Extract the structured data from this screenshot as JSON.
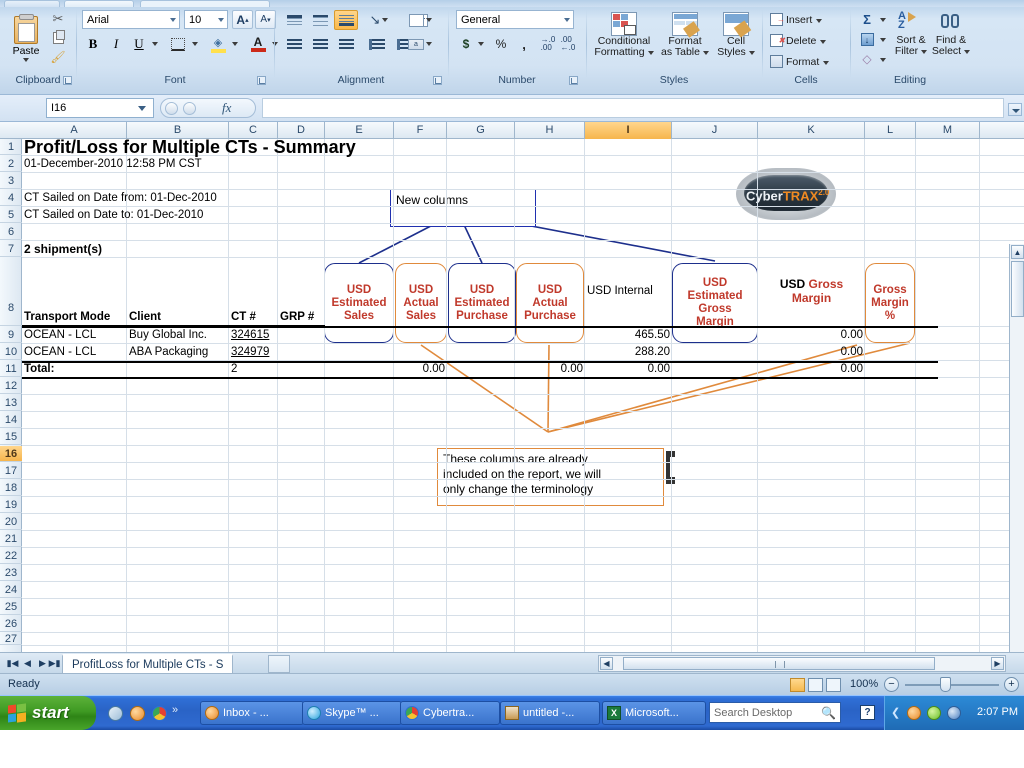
{
  "ribbon": {
    "groups": [
      {
        "name": "Clipboard",
        "label": "Clipboard"
      },
      {
        "name": "Font",
        "label": "Font"
      },
      {
        "name": "Alignment",
        "label": "Alignment"
      },
      {
        "name": "Number",
        "label": "Number"
      },
      {
        "name": "Styles",
        "label": "Styles"
      },
      {
        "name": "Cells",
        "label": "Cells"
      },
      {
        "name": "Editing",
        "label": "Editing"
      }
    ],
    "clipboard": {
      "paste": "Paste",
      "cut": "cut-icon",
      "copy": "copy-icon",
      "format_painter": "format-painter-icon"
    },
    "font": {
      "font_name": "Arial",
      "font_size": "10",
      "grow": "A",
      "shrink": "A",
      "bold": "B",
      "italic": "I",
      "underline": "U"
    },
    "number": {
      "format": "General",
      "currency": "$",
      "percent": "%",
      "comma": ","
    },
    "styles": {
      "conditional_formatting_l1": "Conditional",
      "conditional_formatting_l2": "Formatting",
      "format_as_table_l1": "Format",
      "format_as_table_l2": "as Table",
      "cell_styles_l1": "Cell",
      "cell_styles_l2": "Styles"
    },
    "cells": {
      "insert": "Insert",
      "delete": "Delete",
      "format": "Format"
    },
    "editing": {
      "autosum": "Σ",
      "sort_filter_l1": "Sort &",
      "sort_filter_l2": "Filter",
      "find_select_l1": "Find &",
      "find_select_l2": "Select"
    }
  },
  "formula_bar": {
    "name_box": "I16",
    "formula_value": "",
    "fx_label": "fx"
  },
  "grid": {
    "columns": [
      "A",
      "B",
      "C",
      "D",
      "E",
      "F",
      "G",
      "H",
      "I",
      "J",
      "K",
      "L",
      "M"
    ],
    "selected_column": "I",
    "rows": [
      "1",
      "2",
      "3",
      "4",
      "5",
      "6",
      "7",
      "8",
      "9",
      "10",
      "11",
      "12",
      "13",
      "14",
      "15",
      "16",
      "17",
      "18",
      "19",
      "20",
      "21",
      "22",
      "23",
      "24",
      "25",
      "26",
      "27"
    ],
    "selected_row": "16",
    "content": {
      "title": "Profit/Loss for Multiple CTs - Summary",
      "timestamp": "01-December-2010 12:58 PM CST",
      "sailed_from": "CT Sailed on Date from: 01-Dec-2010",
      "sailed_to": "CT Sailed on Date to: 01-Dec-2010",
      "shipment_count": "2 shipment(s)",
      "headers": {
        "transport_mode": "Transport Mode",
        "client": "Client",
        "ct_number": "CT #",
        "grp_number": "GRP #"
      },
      "column_boxes": [
        {
          "col": "E",
          "outline": "blue",
          "lines": [
            "USD",
            "Estimated",
            "Sales"
          ]
        },
        {
          "col": "F",
          "outline": "orange",
          "lines": [
            "USD",
            "Actual",
            "Sales"
          ]
        },
        {
          "col": "G",
          "outline": "blue",
          "lines": [
            "USD",
            "Estimated",
            "Purchase"
          ]
        },
        {
          "col": "H",
          "outline": "orange",
          "lines": [
            "USD",
            "Actual",
            "Purchase"
          ]
        },
        {
          "col": "J",
          "outline": "blue",
          "lines": [
            "USD",
            "Estimated",
            "Gross",
            "Margin"
          ]
        },
        {
          "col": "L",
          "outline": "orange",
          "lines": [
            "Gross",
            "Margin",
            "%"
          ]
        }
      ],
      "usd_internal": "USD Internal",
      "usd_gross_margin_black": "USD ",
      "usd_gross_margin_red": "Gross Margin",
      "rows_data": [
        {
          "row": "9",
          "transport_mode": "OCEAN - LCL",
          "client": "Buy Global Inc.",
          "ct": "324615",
          "grp": "",
          "e": "",
          "f": "",
          "g": "",
          "h": "",
          "i": "465.50",
          "j": "",
          "k": "0.00",
          "l": ""
        },
        {
          "row": "10",
          "transport_mode": "OCEAN - LCL",
          "client": "ABA Packaging",
          "ct": "324979",
          "grp": "",
          "e": "",
          "f": "",
          "g": "",
          "h": "",
          "i": "288.20",
          "j": "",
          "k": "0.00",
          "l": ""
        }
      ],
      "total_row": {
        "label": "Total:",
        "ct": "2",
        "f": "0.00",
        "h": "0.00",
        "i": "0.00",
        "k": "0.00"
      }
    },
    "callouts": [
      {
        "name": "new-columns",
        "outline": "blue",
        "text": "New columns"
      },
      {
        "name": "already-included",
        "outline": "orange",
        "lines": [
          "These columns are already",
          "included on the report, we will",
          "only change the terminology"
        ]
      }
    ],
    "logo": {
      "part1": "Cyber",
      "part2": "TRAX",
      "sup": "2.0"
    }
  },
  "sheet_tabs": {
    "active_tab": "ProfitLoss for Multiple CTs - S",
    "nav_first": "▮◀",
    "nav_prev": "◀",
    "nav_next": "▶",
    "nav_last": "▶▮"
  },
  "status_bar": {
    "state": "Ready",
    "zoom": "100%",
    "zoom_out": "−",
    "zoom_in": "+"
  },
  "taskbar": {
    "start": "start",
    "buttons": [
      {
        "name": "inbox",
        "label": "Inbox - ...",
        "icon": "mail-icon"
      },
      {
        "name": "skype",
        "label": "Skype™ ...",
        "icon": "skype-icon"
      },
      {
        "name": "cybertrax",
        "label": "Cybertra...",
        "icon": "chrome-icon"
      },
      {
        "name": "untitled",
        "label": "untitled -...",
        "icon": "paint-icon"
      },
      {
        "name": "microsoft-excel",
        "label": "Microsoft...",
        "icon": "excel-icon"
      }
    ],
    "search_placeholder": "Search Desktop",
    "clock": "2:07 PM"
  },
  "colors": {
    "accent_orange": "#e08a3c",
    "accent_blue": "#1d2f8c",
    "header_red": "#c0392b",
    "selection": "#f6b54d"
  }
}
